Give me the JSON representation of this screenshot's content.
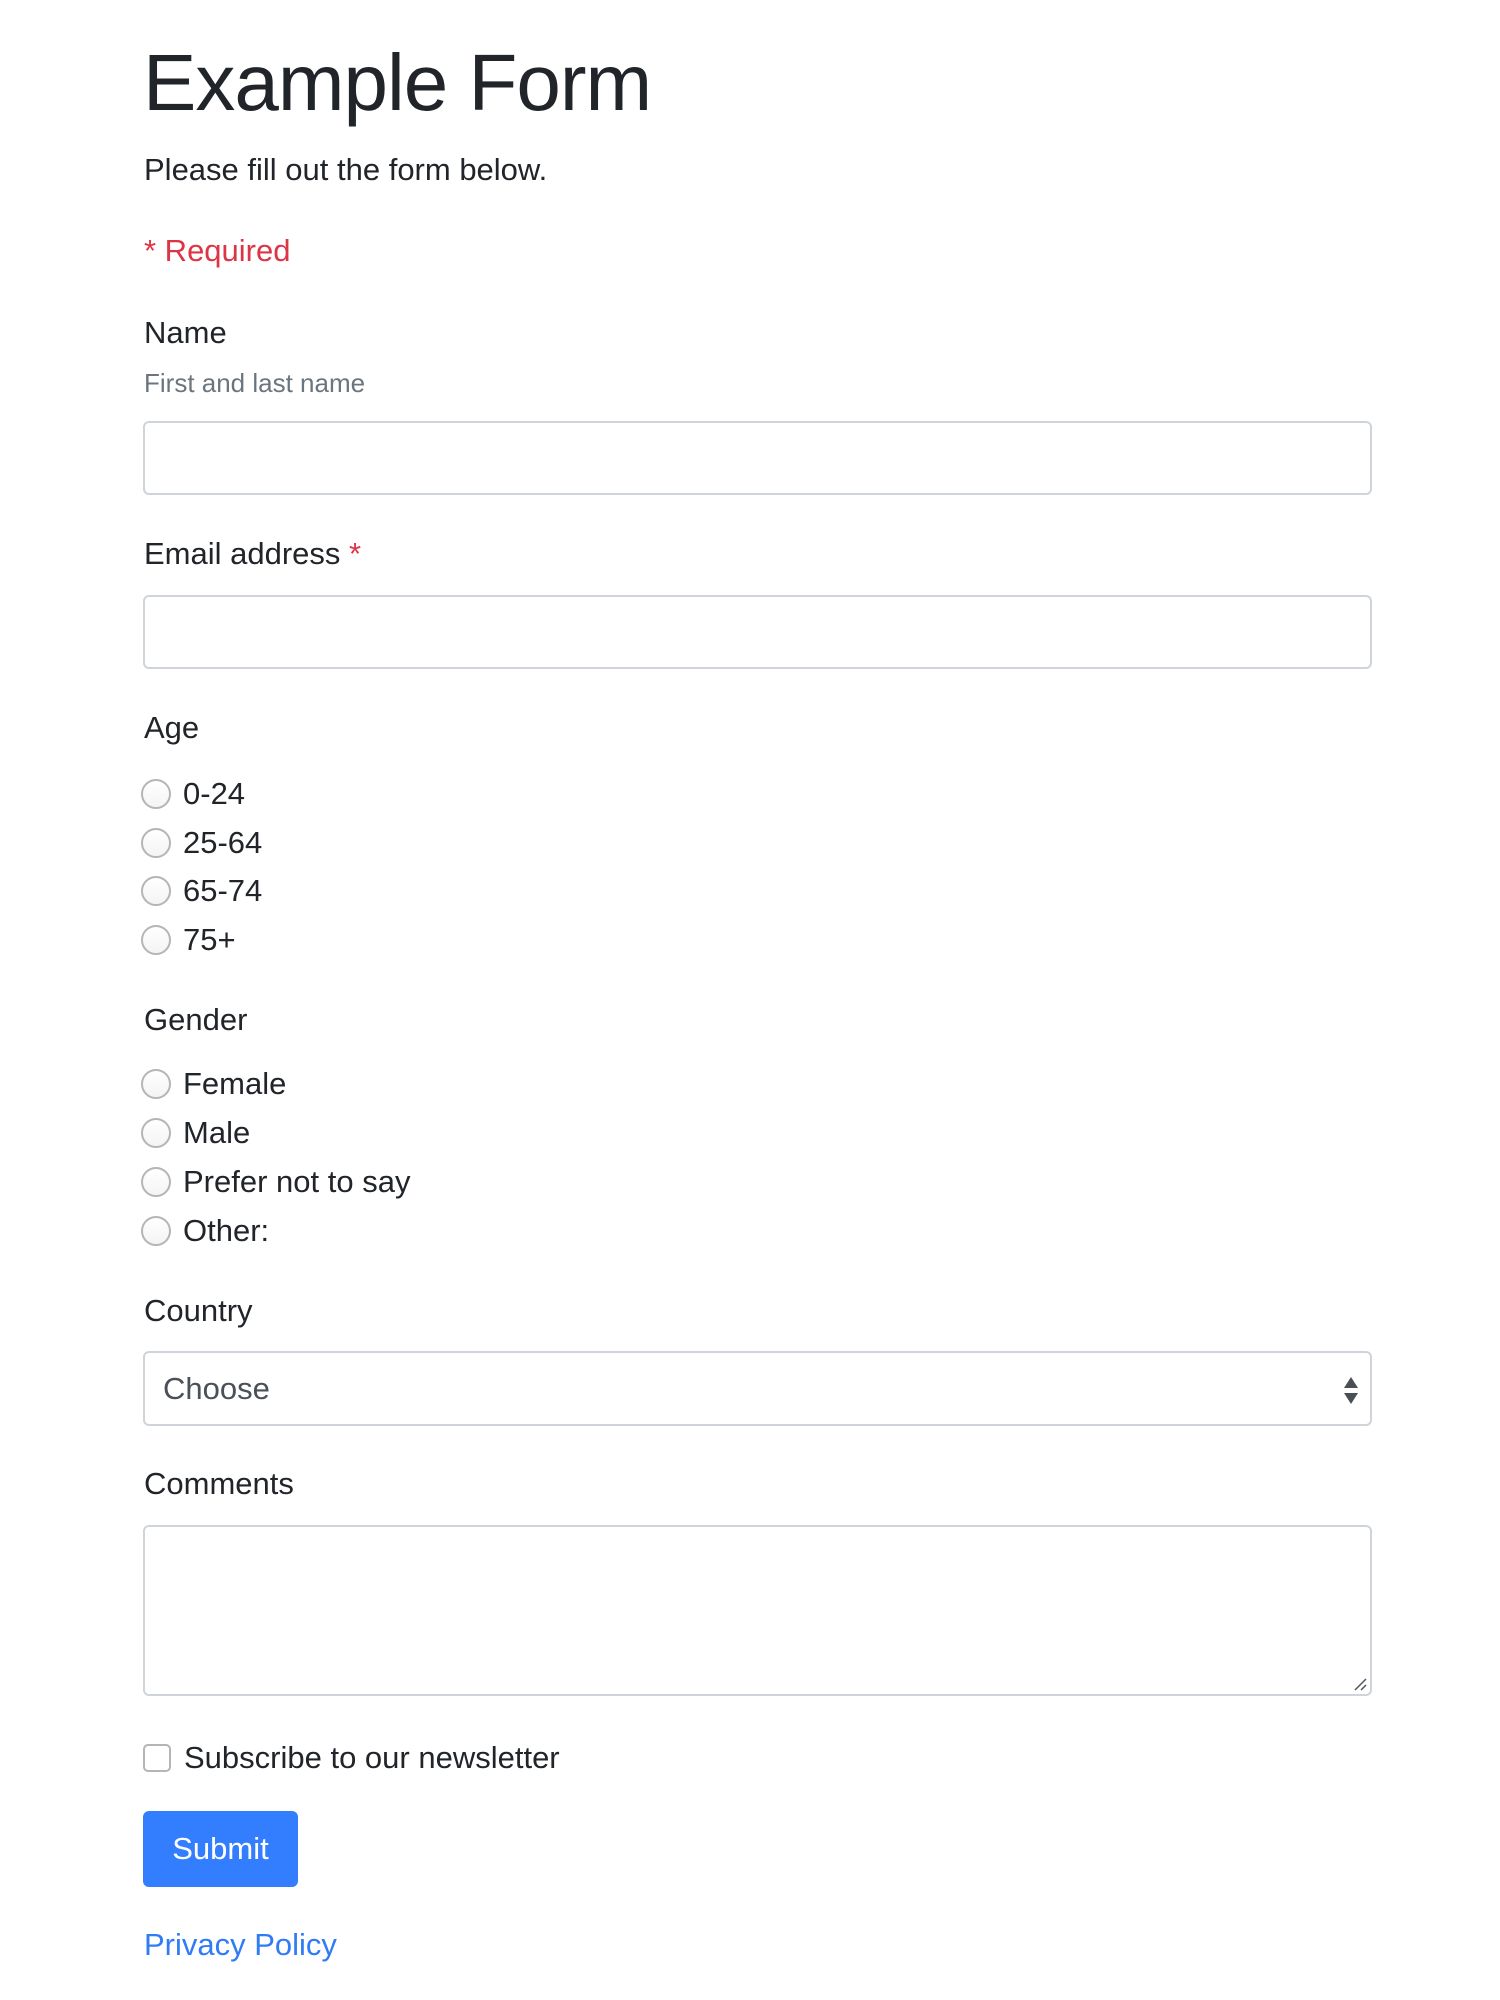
{
  "page": {
    "title": "Example Form",
    "lead": "Please fill out the form below.",
    "required_note": "* Required"
  },
  "form": {
    "name": {
      "label": "Name",
      "hint": "First and last name",
      "value": ""
    },
    "email": {
      "label": "Email address",
      "required_marker": "*",
      "value": ""
    },
    "age": {
      "label": "Age",
      "options": [
        "0-24",
        "25-64",
        "65-74",
        "75+"
      ],
      "selected": null
    },
    "gender": {
      "label": "Gender",
      "options": [
        "Female",
        "Male",
        "Prefer not to say",
        "Other:"
      ],
      "selected": null
    },
    "country": {
      "label": "Country",
      "selected": "Choose"
    },
    "comments": {
      "label": "Comments",
      "value": ""
    },
    "newsletter": {
      "label": "Subscribe to our newsletter",
      "checked": false
    },
    "submit_label": "Submit"
  },
  "footer": {
    "privacy_link": "Privacy Policy"
  },
  "colors": {
    "primary": "#337eff",
    "danger": "#dc3545",
    "link": "#2f7cf6",
    "muted": "#6c757d",
    "text": "#212529"
  }
}
